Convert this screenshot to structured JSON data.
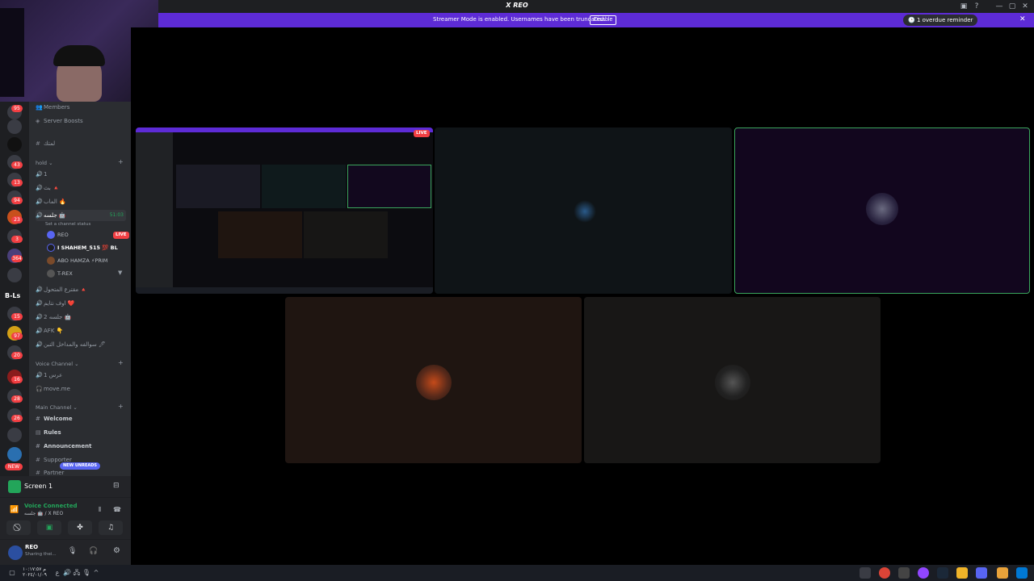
{
  "app": {
    "title": "X REO"
  },
  "window_controls": {
    "minimize": "—",
    "maximize": "▢",
    "close": "✕"
  },
  "banner": {
    "text": "Streamer Mode is enabled. Usernames have been truncated.",
    "button": "Disable",
    "reminder": "1 overdue reminder",
    "close": "✕"
  },
  "guilds": {
    "badges": [
      "95",
      "43",
      "13",
      "94",
      "23",
      "3",
      "364",
      "15",
      "97",
      "20",
      "16",
      "28",
      "26"
    ],
    "labels": [
      "B-Ls",
      "NEW"
    ]
  },
  "channels": {
    "top": [
      {
        "icon": "members-icon",
        "label": "Members"
      },
      {
        "icon": "boost-icon",
        "label": "Server Boosts"
      }
    ],
    "text_top": {
      "label": "لمتك"
    },
    "hold_category": "hold",
    "hold": [
      {
        "label": "1"
      },
      {
        "label": "بث 🔺"
      },
      {
        "label": "الماب 🔥"
      },
      {
        "label": "جلسه 🤖",
        "timer": "51:03",
        "status": "Set a channel status"
      }
    ],
    "voice_users": [
      {
        "name": "REO",
        "tag": "LIVE"
      },
      {
        "name": "I SHAHEM_515 💯 BL"
      },
      {
        "name": "ABO HAMZA ⚡PRIM"
      },
      {
        "name": "T-REX"
      }
    ],
    "more_voice": [
      {
        "label": "مقترع المتحول 🔺"
      },
      {
        "label": "اوف نتايم ❤️"
      },
      {
        "label": "جلسه 2 🤖"
      },
      {
        "label": "AFK 👇"
      },
      {
        "label": "سوالفه والمداخل التبن 🖊"
      }
    ],
    "voice_category": "Voice Channel",
    "voice_channels": [
      {
        "label": "عرس 1"
      },
      {
        "label": "move.me"
      }
    ],
    "main_category": "Main Channel",
    "main": [
      {
        "label": "Welcome"
      },
      {
        "label": "Rules"
      },
      {
        "label": "Announcement"
      },
      {
        "label": "Supporter"
      },
      {
        "label": "Partner"
      }
    ],
    "new_unreads": "NEW UNREADS"
  },
  "screen_panel": {
    "label": "Screen 1"
  },
  "voice_panel": {
    "status": "Voice Connected",
    "channel": "جلسه 🤖 / X REO"
  },
  "user_panel": {
    "name": "REO",
    "status": "Sharing thei..."
  },
  "stage": {
    "live_badge": "LIVE"
  },
  "taskbar": {
    "time": "م ١٠:١٧:٥٧",
    "date": "٢٠٢٤/٠١/٠٩"
  },
  "colors": {
    "accent": "#5d2bd6",
    "live": "#f23f43",
    "online": "#23a55a",
    "speaking_border": "#3ba55d"
  }
}
